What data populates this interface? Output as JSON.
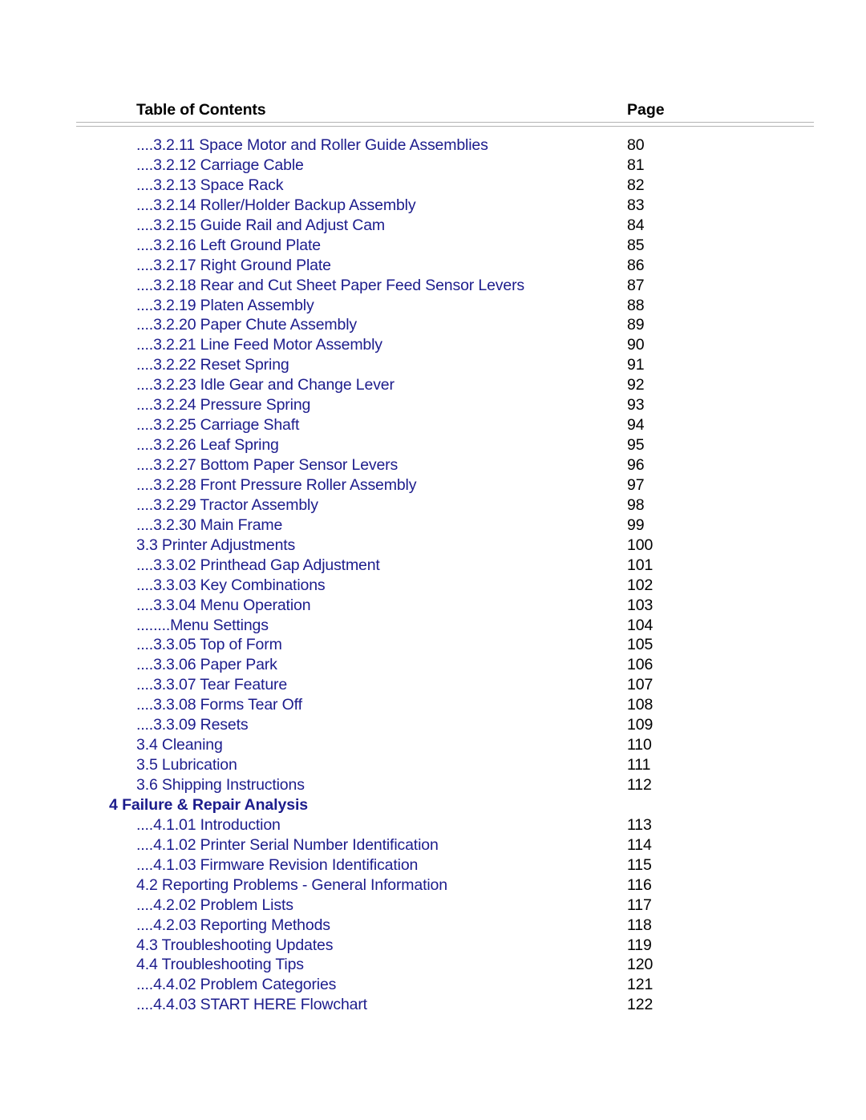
{
  "document": {
    "type": "table-of-contents",
    "header": {
      "title": "Table of Contents",
      "page_label": "Page"
    },
    "colors": {
      "entry_text": "#1c1c8c",
      "page_number_text": "#000000",
      "header_text": "#000000",
      "rule": "#b3b3b3",
      "background": "#ffffff"
    },
    "entries": [
      {
        "label": "....3.2.11 Space Motor and Roller Guide Assemblies",
        "page": "80",
        "style": "dotted"
      },
      {
        "label": "....3.2.12 Carriage Cable",
        "page": "81",
        "style": "dotted"
      },
      {
        "label": "....3.2.13 Space Rack",
        "page": "82",
        "style": "dotted"
      },
      {
        "label": "....3.2.14 Roller/Holder Backup Assembly",
        "page": "83",
        "style": "dotted"
      },
      {
        "label": "....3.2.15 Guide Rail and Adjust Cam",
        "page": "84",
        "style": "dotted"
      },
      {
        "label": "....3.2.16 Left Ground Plate",
        "page": "85",
        "style": "dotted"
      },
      {
        "label": "....3.2.17 Right Ground Plate",
        "page": "86",
        "style": "dotted"
      },
      {
        "label": "....3.2.18 Rear and Cut Sheet Paper Feed Sensor Levers",
        "page": "87",
        "style": "dotted"
      },
      {
        "label": "....3.2.19 Platen Assembly",
        "page": "88",
        "style": "dotted"
      },
      {
        "label": "....3.2.20 Paper Chute Assembly",
        "page": "89",
        "style": "dotted"
      },
      {
        "label": "....3.2.21 Line Feed Motor Assembly",
        "page": "90",
        "style": "dotted"
      },
      {
        "label": "....3.2.22 Reset Spring",
        "page": "91",
        "style": "dotted"
      },
      {
        "label": "....3.2.23 Idle Gear and Change Lever",
        "page": "92",
        "style": "dotted"
      },
      {
        "label": "....3.2.24 Pressure Spring",
        "page": "93",
        "style": "dotted"
      },
      {
        "label": "....3.2.25 Carriage Shaft",
        "page": "94",
        "style": "dotted"
      },
      {
        "label": "....3.2.26 Leaf Spring",
        "page": "95",
        "style": "dotted"
      },
      {
        "label": "....3.2.27 Bottom Paper Sensor Levers",
        "page": "96",
        "style": "dotted"
      },
      {
        "label": "....3.2.28 Front Pressure Roller Assembly",
        "page": "97",
        "style": "dotted"
      },
      {
        "label": "....3.2.29 Tractor Assembly",
        "page": "98",
        "style": "dotted"
      },
      {
        "label": "....3.2.30 Main Frame",
        "page": "99",
        "style": "dotted"
      },
      {
        "label": "3.3 Printer Adjustments",
        "page": "100",
        "style": "plain"
      },
      {
        "label": "....3.3.02 Printhead Gap Adjustment",
        "page": "101",
        "style": "dotted"
      },
      {
        "label": "....3.3.03 Key Combinations",
        "page": "102",
        "style": "dotted"
      },
      {
        "label": "....3.3.04 Menu Operation",
        "page": "103",
        "style": "dotted"
      },
      {
        "label": "........Menu Settings",
        "page": "104",
        "style": "dotted"
      },
      {
        "label": "....3.3.05 Top of Form",
        "page": "105",
        "style": "dotted"
      },
      {
        "label": "....3.3.06 Paper Park",
        "page": "106",
        "style": "dotted"
      },
      {
        "label": "....3.3.07 Tear Feature",
        "page": "107",
        "style": "dotted"
      },
      {
        "label": "....3.3.08 Forms Tear Off",
        "page": "108",
        "style": "dotted"
      },
      {
        "label": "....3.3.09 Resets",
        "page": "109",
        "style": "dotted"
      },
      {
        "label": "3.4 Cleaning",
        "page": "110",
        "style": "plain"
      },
      {
        "label": "3.5 Lubrication",
        "page": "111",
        "style": "plain"
      },
      {
        "label": "3.6 Shipping Instructions",
        "page": "112",
        "style": "plain"
      },
      {
        "label": "4 Failure & Repair Analysis",
        "page": "",
        "style": "section"
      },
      {
        "label": "....4.1.01 Introduction",
        "page": "113",
        "style": "dotted"
      },
      {
        "label": "....4.1.02 Printer Serial Number Identification",
        "page": "114",
        "style": "dotted"
      },
      {
        "label": "....4.1.03 Firmware Revision Identification",
        "page": "115",
        "style": "dotted"
      },
      {
        "label": "4.2 Reporting Problems - General Information",
        "page": "116",
        "style": "plain"
      },
      {
        "label": "....4.2.02 Problem Lists",
        "page": "117",
        "style": "dotted"
      },
      {
        "label": "....4.2.03 Reporting Methods",
        "page": "118",
        "style": "dotted"
      },
      {
        "label": "4.3 Troubleshooting Updates",
        "page": "119",
        "style": "plain"
      },
      {
        "label": "4.4 Troubleshooting Tips",
        "page": "120",
        "style": "plain"
      },
      {
        "label": "....4.4.02 Problem Categories",
        "page": "121",
        "style": "dotted"
      },
      {
        "label": "....4.4.03 START HERE Flowchart",
        "page": "122",
        "style": "dotted"
      }
    ]
  }
}
